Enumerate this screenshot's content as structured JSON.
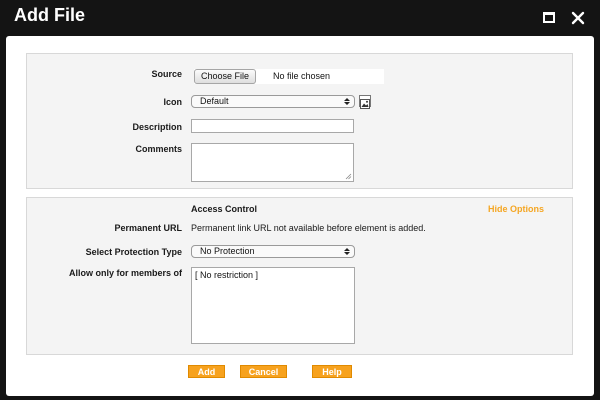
{
  "window": {
    "title": "Add File",
    "maximize_icon": "maximize-icon",
    "close_icon": "close-icon"
  },
  "colors": {
    "titlebar_bg": "#141414",
    "accent_orange": "#f7a21e",
    "link_orange": "#f5a623",
    "section_bg": "#f4f4f4"
  },
  "form": {
    "source": {
      "label": "Source",
      "button_label": "Choose File",
      "status": "No file chosen"
    },
    "icon": {
      "label": "Icon",
      "selected": "Default",
      "preview_icon": "image-icon"
    },
    "description": {
      "label": "Description",
      "value": ""
    },
    "comments": {
      "label": "Comments",
      "value": ""
    }
  },
  "access": {
    "heading": "Access Control",
    "hide_options": "Hide Options",
    "permanent_url": {
      "label": "Permanent URL",
      "value": "Permanent link URL not available before element is added."
    },
    "protection": {
      "label": "Select Protection Type",
      "selected": "No Protection"
    },
    "members": {
      "label": "Allow only for members of",
      "items": [
        "[ No restriction ]"
      ]
    }
  },
  "actions": {
    "add": "Add",
    "cancel": "Cancel",
    "help": "Help"
  }
}
